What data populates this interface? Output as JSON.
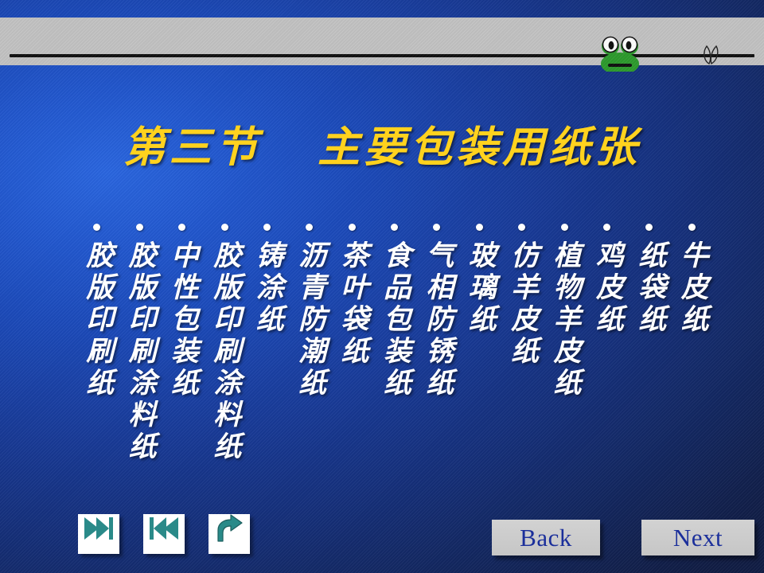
{
  "slide": {
    "title": "第三节   主要包装用纸张",
    "background_color": "#1a40a4",
    "title_color": "#ffd21e",
    "body_text_color": "#ffffff"
  },
  "header": {
    "bar_color": "#c3c3c3",
    "rule_color": "#111111",
    "frog_icon_name": "frog-icon",
    "glyph_icon_name": "leaf-glyph-icon",
    "frog_body_color": "#2e9b2e",
    "frog_eye_color": "#ffffff"
  },
  "bullets": [
    {
      "text": "牛皮纸"
    },
    {
      "text": "纸袋纸"
    },
    {
      "text": "鸡皮纸"
    },
    {
      "text": "植物羊皮纸"
    },
    {
      "text": "仿羊皮纸"
    },
    {
      "text": "玻璃纸"
    },
    {
      "text": "气相防锈纸"
    },
    {
      "text": "食品包装纸"
    },
    {
      "text": "茶叶袋纸"
    },
    {
      "text": "沥青防潮纸"
    },
    {
      "text": "铸涂纸"
    },
    {
      "text": "胶版印刷涂料纸"
    },
    {
      "text": "中性包装纸"
    },
    {
      "text": "胶版印刷涂料纸"
    },
    {
      "text": "胶版印刷纸"
    }
  ],
  "controls": {
    "forward_icon": "fast-forward-icon",
    "rewind_icon": "fast-rewind-icon",
    "return_icon": "return-arrow-icon",
    "icon_color": "#2a8a89",
    "back_label": "Back",
    "next_label": "Next",
    "nav_text_color": "#1b2f9b"
  }
}
